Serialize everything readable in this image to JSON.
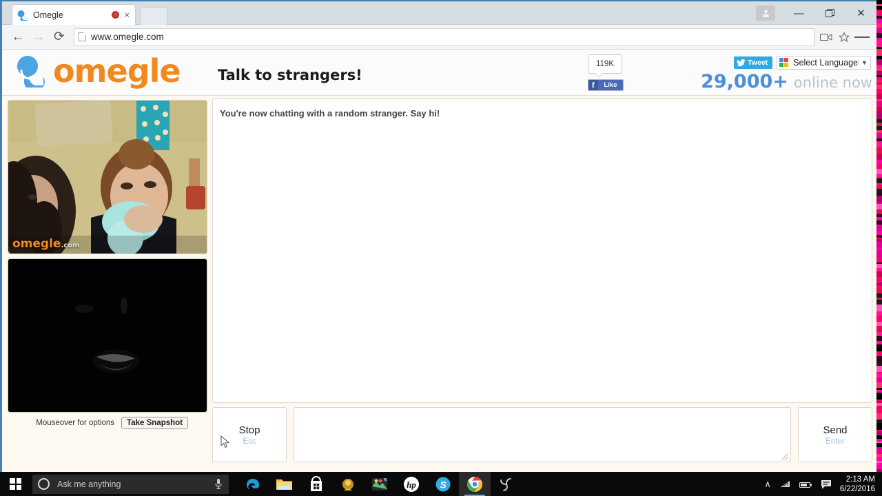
{
  "browser": {
    "tab": {
      "title": "Omegle",
      "favicon": "omegle-favicon",
      "recording_indicator": "red-dot",
      "close": "×"
    },
    "new_tab_label": "",
    "window_controls": {
      "profile": "profile-icon",
      "minimize": "—",
      "maximize": "❐",
      "close": "✕"
    },
    "nav": {
      "back": "←",
      "forward": "→",
      "reload": "⟳"
    },
    "omnibox": {
      "url": "www.omegle.com",
      "page_icon": "document-icon"
    },
    "omnibox_right": {
      "cast": "video-cast-icon",
      "bookmark": "☆",
      "menu": "hamburger-menu-icon"
    }
  },
  "page": {
    "logo_word": "omegle",
    "tagline": "Talk to strangers!",
    "facebook": {
      "count": "119K",
      "f": "f",
      "like_label": "Like"
    },
    "twitter": {
      "label": "Tweet"
    },
    "language": {
      "label": "Select Language",
      "arrow": "▼"
    },
    "online": {
      "count": "29,000+",
      "suffix": "online now"
    },
    "video": {
      "stranger_watermark": "omegle",
      "stranger_watermark_tld": ".com",
      "mouseover_text": "Mouseover for options",
      "snapshot_button": "Take Snapshot"
    },
    "chat": {
      "messages": [
        "You're now chatting with a random stranger. Say hi!"
      ],
      "input_value": "",
      "input_placeholder": "",
      "stop_button": {
        "label": "Stop",
        "shortcut": "Esc"
      },
      "send_button": {
        "label": "Send",
        "shortcut": "Enter"
      }
    }
  },
  "taskbar": {
    "start": "windows-start-icon",
    "search": {
      "placeholder": "Ask me anything",
      "ring": "cortana-ring-icon",
      "mic": "microphone-icon"
    },
    "apps": [
      {
        "name": "edge",
        "label": "e"
      },
      {
        "name": "file-explorer",
        "label": ""
      },
      {
        "name": "microsoft-store",
        "label": ""
      },
      {
        "name": "app-gold",
        "label": ""
      },
      {
        "name": "photos",
        "label": ""
      },
      {
        "name": "hp-support",
        "label": "hp"
      },
      {
        "name": "skype",
        "label": "S"
      },
      {
        "name": "google-chrome",
        "label": ""
      },
      {
        "name": "app-spinner",
        "label": ""
      }
    ],
    "tray": {
      "chevron": "∧",
      "wifi": "wifi-icon",
      "battery": "battery-icon",
      "action_center": "notification-icon"
    },
    "clock": {
      "time": "2:13 AM",
      "date": "6/22/2016"
    }
  },
  "colors": {
    "omegle_orange": "#f08a1e",
    "omegle_blue": "#4a90d9",
    "accent_blue": "#5ca9e8",
    "facebook_blue": "#3b5998",
    "twitter_blue": "#2daae1",
    "page_bg": "#fdf8f0"
  }
}
